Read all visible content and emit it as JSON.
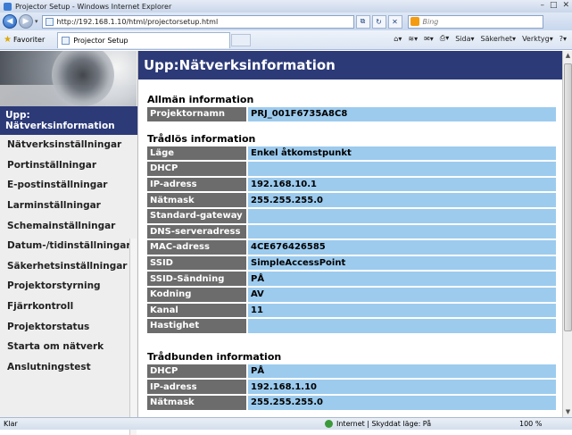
{
  "window": {
    "title": "Projector Setup - Windows Internet Explorer"
  },
  "address": {
    "url": "http://192.168.1.10/html/projectorsetup.html",
    "search_placeholder": "Bing"
  },
  "favorites": {
    "label": "Favoriter",
    "tab_title": "Projector Setup"
  },
  "commands": {
    "page": "Sida",
    "safety": "Säkerhet",
    "tools": "Verktyg"
  },
  "sidebar": {
    "active": "Upp: Nätverksinformation",
    "items": [
      "Nätverksinställningar",
      "Portinställningar",
      "E-postinställningar",
      "Larminställningar",
      "Schemainställningar",
      "Datum-/tidinställningar",
      "Säkerhetsinställningar",
      "Projektorstyrning",
      "Fjärrkontroll",
      "Projektorstatus",
      "Starta om nätverk",
      "Anslutningstest"
    ]
  },
  "main": {
    "title": "Upp:Nätverksinformation",
    "general": {
      "heading": "Allmän information",
      "rows": [
        {
          "key": "Projektornamn",
          "value": "PRJ_001F6735A8C8"
        }
      ]
    },
    "wireless": {
      "heading": "Trådlös information",
      "rows": [
        {
          "key": "Läge",
          "value": "Enkel åtkomstpunkt"
        },
        {
          "key": "DHCP",
          "value": ""
        },
        {
          "key": "IP-adress",
          "value": "192.168.10.1"
        },
        {
          "key": "Nätmask",
          "value": "255.255.255.0"
        },
        {
          "key": "Standard-gateway",
          "value": ""
        },
        {
          "key": "DNS-serveradress",
          "value": ""
        },
        {
          "key": "MAC-adress",
          "value": "4CE676426585"
        },
        {
          "key": "SSID",
          "value": "SimpleAccessPoint"
        },
        {
          "key": "SSID-Sändning",
          "value": "PÅ"
        },
        {
          "key": "Kodning",
          "value": "AV"
        },
        {
          "key": "Kanal",
          "value": "11"
        },
        {
          "key": "Hastighet",
          "value": ""
        }
      ]
    },
    "wired": {
      "heading": "Trådbunden information",
      "rows": [
        {
          "key": "DHCP",
          "value": "PÅ"
        },
        {
          "key": "IP-adress",
          "value": "192.168.1.10"
        },
        {
          "key": "Nätmask",
          "value": "255.255.255.0"
        }
      ]
    }
  },
  "status": {
    "left": "Klar",
    "zone": "Internet | Skyddat läge: På",
    "zoom": "100 %"
  }
}
